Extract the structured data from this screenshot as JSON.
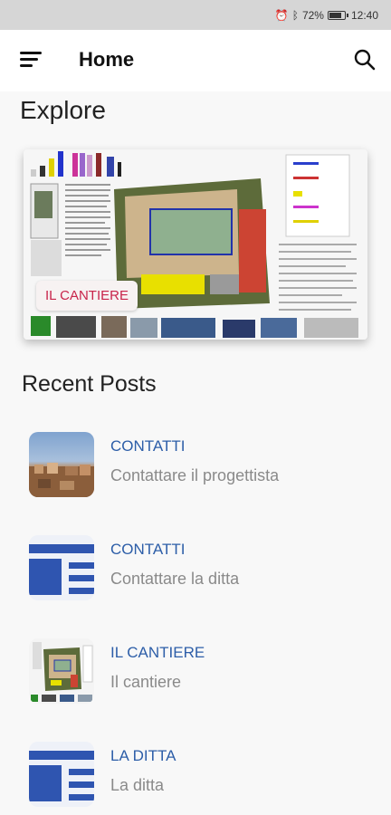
{
  "status": {
    "battery": "72%",
    "time": "12:40"
  },
  "app_bar": {
    "title": "Home"
  },
  "explore": {
    "title": "Explore",
    "hero_label": "IL CANTIERE"
  },
  "recent": {
    "title": "Recent Posts",
    "posts": [
      {
        "title": "CONTATTI",
        "subtitle": "Contattare il progettista"
      },
      {
        "title": "CONTATTI",
        "subtitle": "Contattare la ditta"
      },
      {
        "title": "IL CANTIERE",
        "subtitle": "Il cantiere"
      },
      {
        "title": "LA DITTA",
        "subtitle": "La ditta"
      }
    ]
  },
  "colors": {
    "accent": "#2d5ea8",
    "hero_label": "#c8244a"
  },
  "icons": [
    "menu-icon",
    "search-icon",
    "bluetooth-icon",
    "battery-icon"
  ]
}
